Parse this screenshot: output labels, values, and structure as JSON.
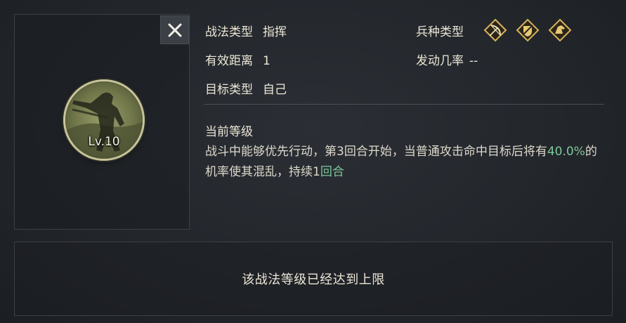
{
  "skill": {
    "level": "Lv.10",
    "type_label": "战法类型",
    "type_value": "指挥",
    "range_label": "有效距离",
    "range_value": "1",
    "target_label": "目标类型",
    "target_value": "自己",
    "troop_label": "兵种类型",
    "troop_icons": [
      "bow-icon",
      "shield-icon",
      "cavalry-icon"
    ],
    "chance_label": "发动几率",
    "chance_value": "--"
  },
  "current_level": {
    "title": "当前等级",
    "desc_part1": "战斗中能够优先行动，第3回合开始，当普通攻击命中目标后将有",
    "desc_highlight1": "40.0%",
    "desc_part2": "的机率使其混乱，持续1",
    "desc_highlight2": "回合"
  },
  "footer": {
    "message": "该战法等级已经达到上限"
  },
  "colors": {
    "highlight": "#7fc79b",
    "troop_gold": "#d8b25a"
  }
}
